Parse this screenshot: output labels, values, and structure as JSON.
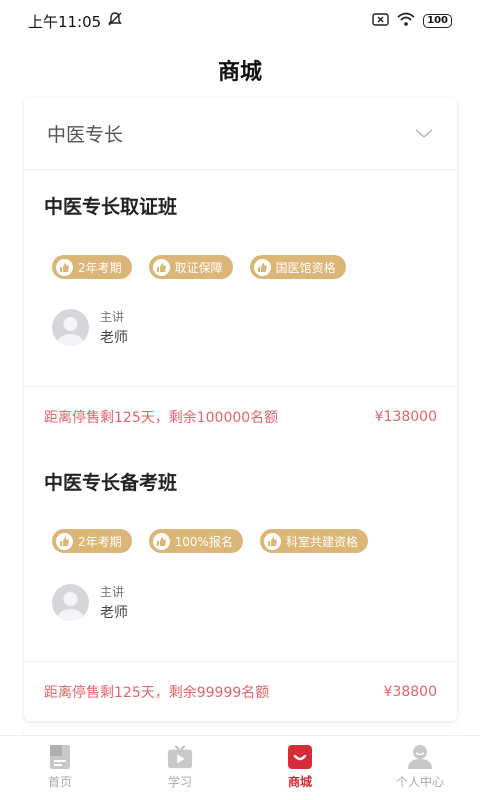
{
  "status_bar": {
    "time": "上午11:05",
    "battery": "100",
    "icons": [
      "mute-icon",
      "sim-icon",
      "wifi-icon",
      "battery-icon"
    ]
  },
  "header": {
    "title": "商城"
  },
  "category": {
    "label": "中医专长",
    "icon": "chevron-down-icon"
  },
  "courses": [
    {
      "title": "中医专长取证班",
      "tags": [
        "2年考期",
        "取证保障",
        "国医馆资格"
      ],
      "teacher_role": "主讲",
      "teacher_name": "老师",
      "sale_info": "距离停售剩125天，剩余100000名额",
      "price": "¥138000"
    },
    {
      "title": "中医专长备考班",
      "tags": [
        "2年考期",
        "100%报名",
        "科室共建资格"
      ],
      "teacher_role": "主讲",
      "teacher_name": "老师",
      "sale_info": "距离停售剩125天，剩余99999名额",
      "price": "¥38800"
    }
  ],
  "tab_bar": {
    "items": [
      {
        "label": "首页",
        "icon": "home-doc-icon"
      },
      {
        "label": "学习",
        "icon": "tv-icon"
      },
      {
        "label": "商城",
        "icon": "shop-bag-icon"
      },
      {
        "label": "个人中心",
        "icon": "person-icon"
      }
    ],
    "active_index": 2,
    "active_color": "#d82b38",
    "inactive_color": "#aaaaaa"
  },
  "colors": {
    "tag_bg": "#dcb676",
    "sale_text": "#e0646a"
  }
}
